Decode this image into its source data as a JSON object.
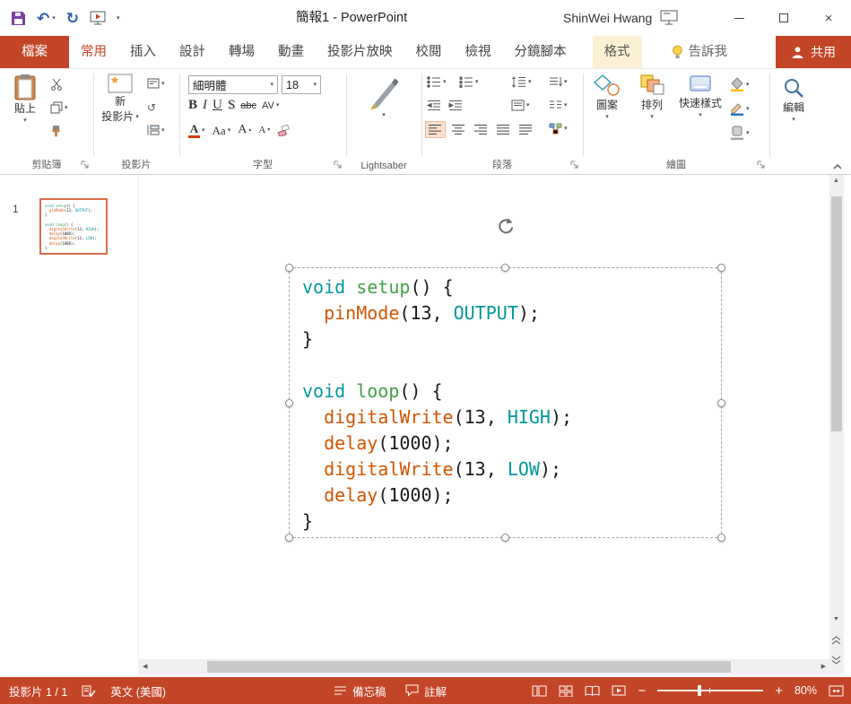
{
  "colors": {
    "accent": "#C34527",
    "contextual_tab_bg": "#FBF0D3",
    "thumbnail_border": "#D96C4B"
  },
  "icons": {
    "dropdown": "▾",
    "caret_up": "▴",
    "undo": "↶",
    "redo": "↻",
    "close": "×",
    "scroll_up": "▲",
    "scroll_down": "▼",
    "scroll_left": "◀",
    "scroll_right": "▶",
    "reset": "↺"
  },
  "titlebar": {
    "title": "簡報1 - PowerPoint",
    "user": "ShinWei Hwang"
  },
  "tabs": [
    {
      "label": "檔案"
    },
    {
      "label": "常用"
    },
    {
      "label": "插入"
    },
    {
      "label": "設計"
    },
    {
      "label": "轉場"
    },
    {
      "label": "動畫"
    },
    {
      "label": "投影片放映"
    },
    {
      "label": "校閱"
    },
    {
      "label": "檢視"
    },
    {
      "label": "分鏡腳本"
    },
    {
      "label": "格式"
    },
    {
      "label": "告訴我"
    },
    {
      "label": "共用"
    }
  ],
  "ribbon": {
    "clipboard": {
      "group_label": "剪貼簿",
      "paste_label": "貼上"
    },
    "slides": {
      "group_label": "投影片",
      "new_slide_line1": "新",
      "new_slide_line2": "投影片"
    },
    "font": {
      "group_label": "字型",
      "font_name": "細明體",
      "font_size": "18",
      "bold": "B",
      "italic": "I",
      "underline": "U",
      "shadow": "S",
      "strikethrough": "abc",
      "char_spacing": "AV",
      "font_color": "A",
      "change_case": "Aa",
      "grow_font": "A",
      "shrink_font": "A"
    },
    "lightsaber": {
      "group_label": "Lightsaber"
    },
    "paragraph": {
      "group_label": "段落"
    },
    "drawing": {
      "group_label": "繪圖",
      "shapes_label": "圖案",
      "arrange_label": "排列",
      "quick_styles_label": "快速樣式"
    },
    "editing": {
      "group_label": "編輯"
    }
  },
  "slide_panel": {
    "slide_number": "1"
  },
  "slide": {
    "code_colors": {
      "kw": "#00979C",
      "fn": "#43A047",
      "call": "#D35400",
      "pl": "#1A1A1A"
    },
    "code_lines": [
      [
        {
          "t": "void",
          "c": "kw"
        },
        {
          "t": " ",
          "c": "pl"
        },
        {
          "t": "setup",
          "c": "fn"
        },
        {
          "t": "() {",
          "c": "pl"
        }
      ],
      [
        {
          "t": "  ",
          "c": "pl"
        },
        {
          "t": "pinMode",
          "c": "call"
        },
        {
          "t": "(13, ",
          "c": "pl"
        },
        {
          "t": "OUTPUT",
          "c": "kw"
        },
        {
          "t": ");",
          "c": "pl"
        }
      ],
      [
        {
          "t": "}",
          "c": "pl"
        }
      ],
      [],
      [
        {
          "t": "void",
          "c": "kw"
        },
        {
          "t": " ",
          "c": "pl"
        },
        {
          "t": "loop",
          "c": "fn"
        },
        {
          "t": "() {",
          "c": "pl"
        }
      ],
      [
        {
          "t": "  ",
          "c": "pl"
        },
        {
          "t": "digitalWrite",
          "c": "call"
        },
        {
          "t": "(13, ",
          "c": "pl"
        },
        {
          "t": "HIGH",
          "c": "kw"
        },
        {
          "t": ");",
          "c": "pl"
        }
      ],
      [
        {
          "t": "  ",
          "c": "pl"
        },
        {
          "t": "delay",
          "c": "call"
        },
        {
          "t": "(1000);",
          "c": "pl"
        }
      ],
      [
        {
          "t": "  ",
          "c": "pl"
        },
        {
          "t": "digitalWrite",
          "c": "call"
        },
        {
          "t": "(13, ",
          "c": "pl"
        },
        {
          "t": "LOW",
          "c": "kw"
        },
        {
          "t": ");",
          "c": "pl"
        }
      ],
      [
        {
          "t": "  ",
          "c": "pl"
        },
        {
          "t": "delay",
          "c": "call"
        },
        {
          "t": "(1000);",
          "c": "pl"
        }
      ],
      [
        {
          "t": "}",
          "c": "pl"
        }
      ]
    ]
  },
  "statusbar": {
    "slide_indicator": "投影片 1 / 1",
    "language": "英文 (美國)",
    "notes_label": "備忘稿",
    "comments_label": "註解",
    "zoom_out": "−",
    "zoom_in": "+",
    "zoom_level": "80%"
  }
}
